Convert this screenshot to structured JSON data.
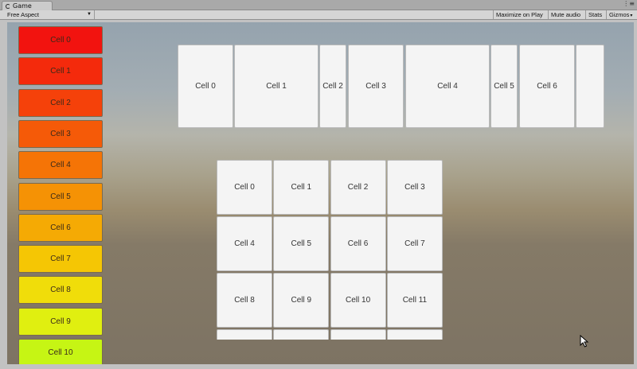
{
  "tab": {
    "title": "Game",
    "menu": "⋮≡"
  },
  "toolbar": {
    "aspect": "Free Aspect",
    "maximize": "Maximize on Play",
    "mute": "Mute audio",
    "stats": "Stats",
    "gizmos": "Gizmos"
  },
  "vertical_list": [
    {
      "label": "Cell 0",
      "color": "#f2130f"
    },
    {
      "label": "Cell 1",
      "color": "#f42a0c"
    },
    {
      "label": "Cell 2",
      "color": "#f5410a"
    },
    {
      "label": "Cell 3",
      "color": "#f55a08"
    },
    {
      "label": "Cell 4",
      "color": "#f57406"
    },
    {
      "label": "Cell 5",
      "color": "#f59205"
    },
    {
      "label": "Cell 6",
      "color": "#f5aa04"
    },
    {
      "label": "Cell 7",
      "color": "#f5c604"
    },
    {
      "label": "Cell 8",
      "color": "#f0dd0a"
    },
    {
      "label": "Cell 9",
      "color": "#e0ef10"
    },
    {
      "label": "Cell 10",
      "color": "#c6f514"
    }
  ],
  "horizontal_list": [
    {
      "label": "Cell 0"
    },
    {
      "label": "Cell 1"
    },
    {
      "label": "Cell 2"
    },
    {
      "label": "Cell 3"
    },
    {
      "label": "Cell 4"
    },
    {
      "label": "Cell 5"
    },
    {
      "label": "Cell 6"
    },
    {
      "label": ""
    }
  ],
  "grid": [
    "Cell 0",
    "Cell 1",
    "Cell 2",
    "Cell 3",
    "Cell 4",
    "Cell 5",
    "Cell 6",
    "Cell 7",
    "Cell 8",
    "Cell 9",
    "Cell 10",
    "Cell 11",
    "",
    "",
    "",
    ""
  ]
}
